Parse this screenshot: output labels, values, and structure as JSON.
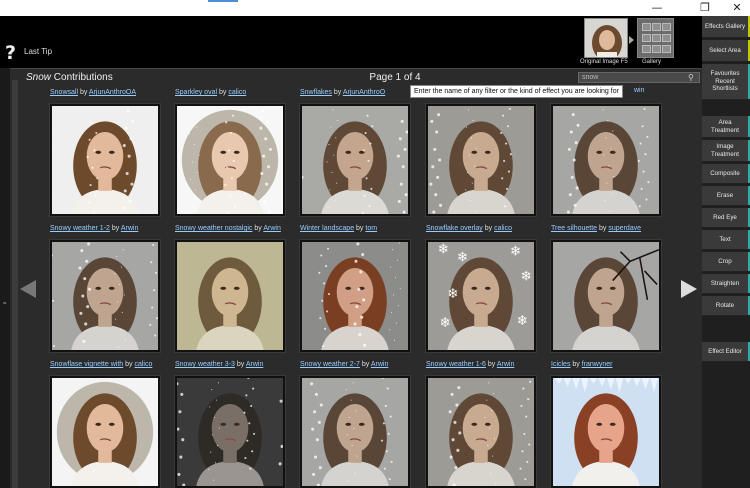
{
  "window": {
    "minimize_icon": "minimize-icon",
    "maximize_icon": "maximize-icon",
    "close_icon": "close-icon",
    "minimize_glyph": "—",
    "maximize_glyph": "❐",
    "close_glyph": "✕"
  },
  "toolbar": {
    "tip_icon": "?",
    "tip_label": "Last Tip",
    "original_image_label": "Original Image F5",
    "gallery_label": "Gallery"
  },
  "gallery": {
    "title_italic": "Snow",
    "title_rest": "Contributions",
    "page_info": "Page 1 of 4",
    "search_value": "snow",
    "search_tooltip": "Enter the name of any filter or the kind of effect you are looking for",
    "tooltip_tail": "win",
    "by": "by",
    "items": [
      {
        "title": "Snowsall",
        "author": "ArjunAnthroOA",
        "style": "snow"
      },
      {
        "title": "Sparkley oval",
        "author": "calico",
        "style": "oval"
      },
      {
        "title": "Snwflakes",
        "author": "ArjunAnthroO",
        "style": "flakes"
      },
      {
        "title": "",
        "author": "",
        "style": "flakes2"
      },
      {
        "title": "",
        "author": "",
        "style": "gray"
      },
      {
        "title": "Snowy weather 1-2",
        "author": "Arwin",
        "style": "gray"
      },
      {
        "title": "Snowy weather nostalgic",
        "author": "Arwin",
        "style": "yellow"
      },
      {
        "title": "Winter landscape",
        "author": "tom",
        "style": "warm"
      },
      {
        "title": "Snowflake overlay",
        "author": "calico",
        "style": "overlay"
      },
      {
        "title": "Tree silhouette",
        "author": "superdave",
        "style": "tree"
      },
      {
        "title": "Snowflase vignette with",
        "author": "calico",
        "style": "vignette"
      },
      {
        "title": "Snowy weather 3-3",
        "author": "Arwin",
        "style": "dark"
      },
      {
        "title": "Snowy weather 2-7",
        "author": "Arwin",
        "style": "gray"
      },
      {
        "title": "Snowy weather 1-6",
        "author": "Arwin",
        "style": "flakes2"
      },
      {
        "title": "Icicles",
        "author": "franwyner",
        "style": "icicle"
      }
    ]
  },
  "sidebar": {
    "items": [
      {
        "label": "Effects Gallery",
        "accent": "#c8c800"
      },
      {
        "label": "Select Area",
        "accent": "#c8c800"
      },
      {
        "label": "Favourites Recent Shortlists",
        "accent": "#3aa"
      },
      {
        "label": "Area Treatment",
        "accent": "#3aa"
      },
      {
        "label": "Image Treatment",
        "accent": "#3aa"
      },
      {
        "label": "Composite",
        "accent": "#3aa"
      },
      {
        "label": "Erase",
        "accent": "#3aa"
      },
      {
        "label": "Red Eye",
        "accent": "#3aa"
      },
      {
        "label": "Text",
        "accent": "#3aa"
      },
      {
        "label": "Crop",
        "accent": "#3aa"
      },
      {
        "label": "Straighten",
        "accent": "#3aa"
      },
      {
        "label": "Rotate",
        "accent": "#3aa"
      },
      {
        "label": "Effect Editor",
        "accent": "#3aa"
      }
    ]
  },
  "navigation": {
    "prev_icon": "arrow-left-icon",
    "next_icon": "arrow-right-icon"
  }
}
